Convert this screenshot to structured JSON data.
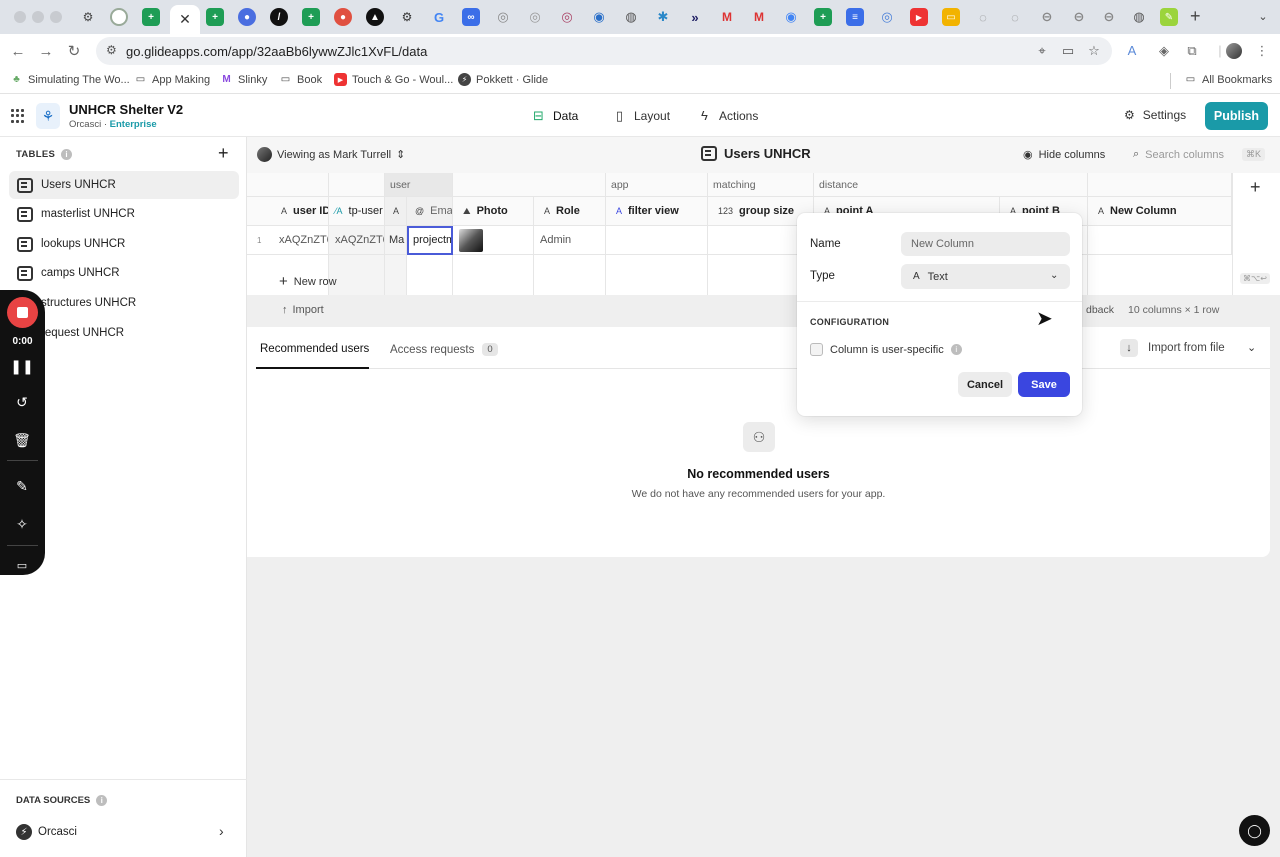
{
  "browser": {
    "url": "go.glideapps.com/app/32aaBb6lywwZJlc1XvFL/data",
    "active_tab_close": "✕",
    "new_tab": "+",
    "tab_search": "⌄",
    "bookmarks": [
      {
        "label": "Simulating The Wo...",
        "icon": "tree-icon"
      },
      {
        "label": "App Making",
        "icon": "folder-icon"
      },
      {
        "label": "Slinky",
        "icon": "m-logo-icon"
      },
      {
        "label": "Book",
        "icon": "folder-icon"
      },
      {
        "label": "Touch & Go - Woul...",
        "icon": "youtube-icon"
      },
      {
        "label": "Pokkett · Glide",
        "icon": "glide-icon"
      }
    ],
    "all_bookmarks": "All Bookmarks"
  },
  "app": {
    "title": "UNHCR Shelter V2",
    "org": "Orcasci · ",
    "plan": "Enterprise",
    "nav": [
      {
        "label": "Data",
        "icon": "data-icon"
      },
      {
        "label": "Layout",
        "icon": "layout-icon"
      },
      {
        "label": "Actions",
        "icon": "actions-icon"
      }
    ],
    "settings_label": "Settings",
    "publish_label": "Publish",
    "accent": "#1a9aa8"
  },
  "sidebar": {
    "tables_header": "TABLES",
    "items": [
      {
        "label": "Users UNHCR",
        "active": true
      },
      {
        "label": "masterlist UNHCR"
      },
      {
        "label": "lookups UNHCR"
      },
      {
        "label": "camps UNHCR"
      },
      {
        "label": "structures UNHCR"
      },
      {
        "label": "request UNHCR"
      }
    ],
    "data_sources_header": "DATA SOURCES",
    "data_source": "Orcasci"
  },
  "subbar": {
    "viewing_as": "Viewing as Mark Turrell",
    "table_title": "Users UNHCR",
    "hide_columns": "Hide columns",
    "search_placeholder": "Search columns",
    "search_kbd": "⌘K"
  },
  "grid": {
    "groups": [
      "user",
      "app",
      "matching",
      "distance"
    ],
    "columns": [
      {
        "type": "A",
        "label": "user ID"
      },
      {
        "type": "A",
        "label": "tp-user"
      },
      {
        "type": "A",
        "label": ""
      },
      {
        "type": "@",
        "label": "Email"
      },
      {
        "type": "img",
        "label": "Photo"
      },
      {
        "type": "A",
        "label": "Role"
      },
      {
        "type": "A",
        "label": "filter view"
      },
      {
        "type": "123",
        "label": "group size"
      },
      {
        "type": "A",
        "label": "point A"
      },
      {
        "type": "A",
        "label": "point B"
      },
      {
        "type": "A",
        "label": "New Column"
      }
    ],
    "row_number": "1",
    "row": {
      "user_id": "xAQZnZT6",
      "tp_user": "xAQZnZT6",
      "name": "Ma",
      "email": "projectm",
      "role": "Admin"
    },
    "new_row": "New row",
    "add_column_kbd": "⌘⌥↩"
  },
  "importbar": {
    "import": "Import",
    "feedback": "dback",
    "count": "10 columns × 1 row"
  },
  "users": {
    "tab_recommended": "Recommended users",
    "tab_access": "Access requests",
    "access_count": "0",
    "import_from_file": "Import from file",
    "empty_title": "No recommended users",
    "empty_sub": "We do not have any recommended users for your app."
  },
  "popover": {
    "name_label": "Name",
    "name_value": "New Column",
    "type_label": "Type",
    "type_value": "Text",
    "config_header": "CONFIGURATION",
    "user_specific": "Column is user-specific",
    "cancel": "Cancel",
    "save": "Save",
    "save_color": "#3a46e0"
  },
  "recorder": {
    "time": "0:00"
  }
}
